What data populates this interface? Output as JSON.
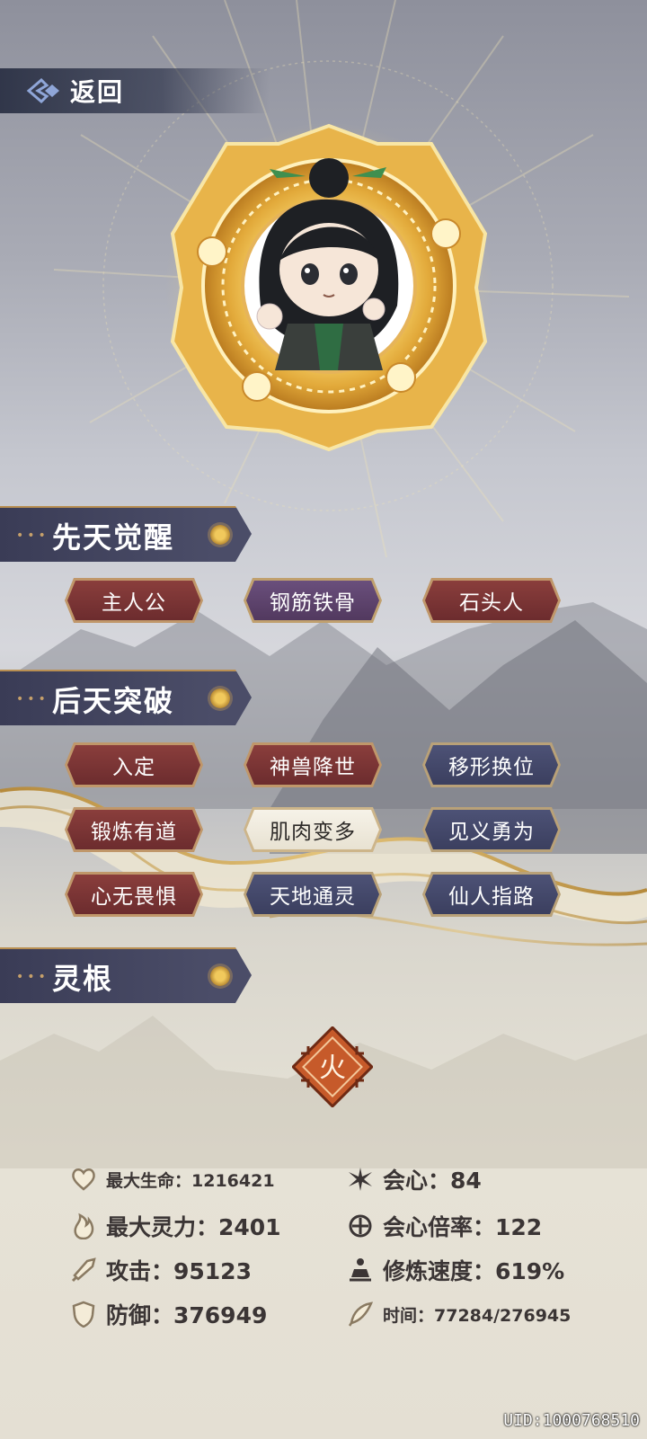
{
  "nav": {
    "back_label": "返回"
  },
  "sections": {
    "innate": {
      "title": "先天觉醒",
      "tags": [
        {
          "label": "主人公",
          "style": "red"
        },
        {
          "label": "钢筋铁骨",
          "style": "purple"
        },
        {
          "label": "石头人",
          "style": "red"
        }
      ]
    },
    "acquired": {
      "title": "后天突破",
      "tags": [
        {
          "label": "入定",
          "style": "red"
        },
        {
          "label": "神兽降世",
          "style": "red"
        },
        {
          "label": "移形换位",
          "style": "blue"
        },
        {
          "label": "锻炼有道",
          "style": "red"
        },
        {
          "label": "肌肉变多",
          "style": "white"
        },
        {
          "label": "见义勇为",
          "style": "blue"
        },
        {
          "label": "心无畏惧",
          "style": "red"
        },
        {
          "label": "天地通灵",
          "style": "blue"
        },
        {
          "label": "仙人指路",
          "style": "blue"
        }
      ]
    },
    "spirit_root": {
      "title": "灵根",
      "element_char": "火"
    }
  },
  "stats": {
    "max_hp": "最大生命：1216421",
    "crit": "会心：84",
    "max_mana": "最大灵力：2401",
    "crit_rate": "会心倍率：122",
    "attack": "攻击：95123",
    "cultivation_speed": "修炼速度：619%",
    "defense": "防御：376949",
    "time": "时间：77284/276945"
  },
  "uid": "UID:1000768510",
  "colors": {
    "accent_gold": "#c6a06a",
    "panel_dark": "#3a3c56",
    "tag_red": "#7a3436",
    "tag_blue": "#444868",
    "tag_purple": "#5e4470"
  },
  "icons": [
    "back-diamond-icon",
    "heart-icon",
    "flame-icon",
    "sword-icon",
    "shield-icon",
    "burst-icon",
    "crit-rate-icon",
    "meditation-icon",
    "feather-icon"
  ]
}
